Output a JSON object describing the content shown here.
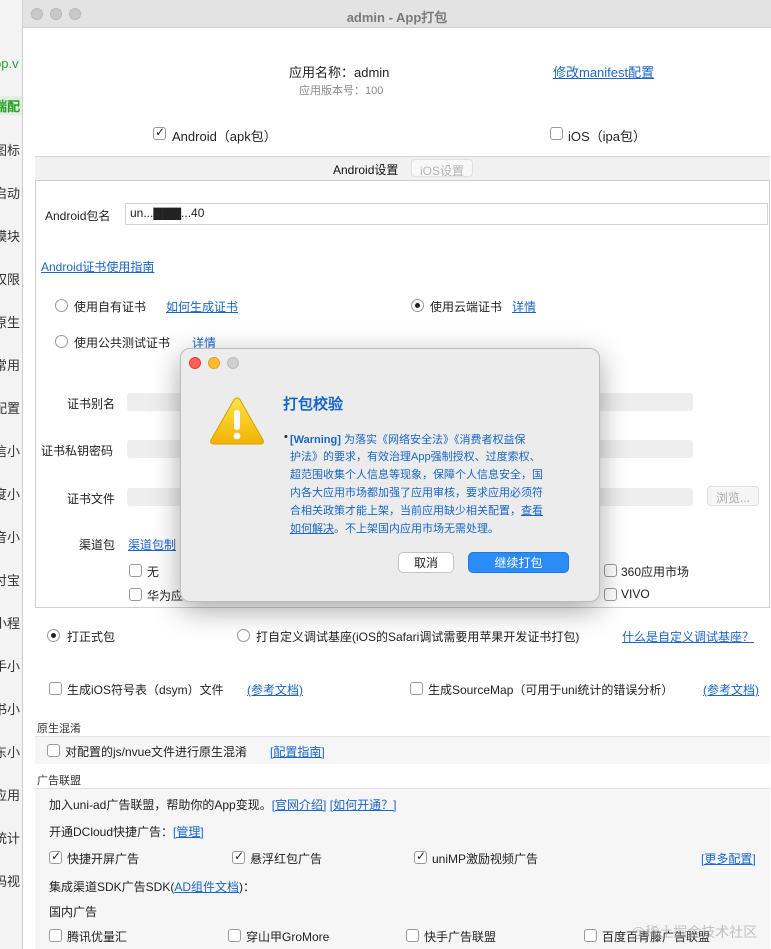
{
  "window": {
    "title": "admin - App打包"
  },
  "background_strip": [
    "pp.v",
    "端配",
    "图标",
    "启动",
    "模块",
    "权限",
    "原生",
    "常用",
    "配置",
    "信小",
    "度小",
    "音小",
    "付宝",
    "小程",
    "手小",
    "书小",
    "东小",
    "应用",
    "统计",
    "码视"
  ],
  "app_info": {
    "name_label": "应用名称：admin",
    "version_label": "应用版本号：100",
    "manifest_link": "修改manifest配置"
  },
  "platforms": {
    "android_label": "Android（apk包）",
    "ios_label": "iOS（ipa包）"
  },
  "tabs": {
    "android": "Android设置",
    "ios": "iOS设置"
  },
  "android": {
    "package_label": "Android包名",
    "package_value": "un...▇▇▇...40",
    "cert_guide_link": "Android证书使用指南",
    "own_cert_label": "使用自有证书",
    "how_to_cert_link": "如何生成证书",
    "cloud_cert_label": "使用云端证书",
    "cloud_detail_link": "详情",
    "public_cert_label": "使用公共测试证书",
    "public_detail_link": "详情",
    "cert_alias_label": "证书别名",
    "cert_key_label": "证书私钥密码",
    "cert_file_label": "证书文件",
    "browse_label": "浏览...",
    "channel_label": "渠道包",
    "channel_link": "渠道包制",
    "channel_none": "无",
    "channel_huawei": "华为应",
    "channel_360": "360应用市场",
    "channel_vivo": "VIVO"
  },
  "build": {
    "formal_label": "打正式包",
    "custom_base_label": "打自定义调试基座(iOS的Safari调试需要用苹果开发证书打包)",
    "custom_base_link": "什么是自定义调试基座？",
    "ios_symbols_label": "生成iOS符号表（dsym）文件",
    "ios_symbols_link": "(参考文档)",
    "sourcemap_label": "生成SourceMap（可用于uni统计的错误分析）",
    "sourcemap_link": "(参考文档)"
  },
  "obfuscation": {
    "header": "原生混淆",
    "label": "对配置的js/nvue文件进行原生混淆",
    "link": "[配置指南]"
  },
  "ads": {
    "header": "广告联盟",
    "intro": "加入uni-ad广告联盟，帮助你的App变现。",
    "intro_link1": "[官网介绍]",
    "intro_link2": "[如何开通？]",
    "dcloud_label": "开通DCloud快捷广告：",
    "dcloud_link": "[管理]",
    "splash": "快捷开屏广告",
    "redpacket": "悬浮红包广告",
    "unimp": "uniMP激励视频广告",
    "more_link": "[更多配置]",
    "sdk_label_pre": "集成渠道SDK广告SDK(",
    "sdk_link": "AD组件文档",
    "sdk_label_post": ")：",
    "domestic": "国内广告",
    "tencent": "腾讯优量汇",
    "gromore": "穿山甲GroMore",
    "kuaishou": "快手广告联盟",
    "baidu": "百度百青藤广告联盟"
  },
  "dialog": {
    "title": "打包校验",
    "warning_tag": "[Warning]",
    "lines": [
      "为落实《网络安全法》《消费者权益保",
      "护法》的要求，有效治理App强制授权、过度索权、",
      "超范围收集个人信息等现象，保障个人信息安全，国",
      "内各大应用市场都加强了应用审核，要求应用必须符",
      "合相关政策才能上架，当前应用缺少相关配置，"
    ],
    "view_link_1": "查看",
    "view_link_2": "如何解决",
    "tail": "。不上架国内应用市场无需处理。",
    "cancel": "取消",
    "continue": "继续打包"
  },
  "watermark": "@稀土掘金技术社区",
  "colors": {
    "link": "#1a66c6",
    "primary": "#2c8cf5",
    "green": "#2a9d2a"
  }
}
